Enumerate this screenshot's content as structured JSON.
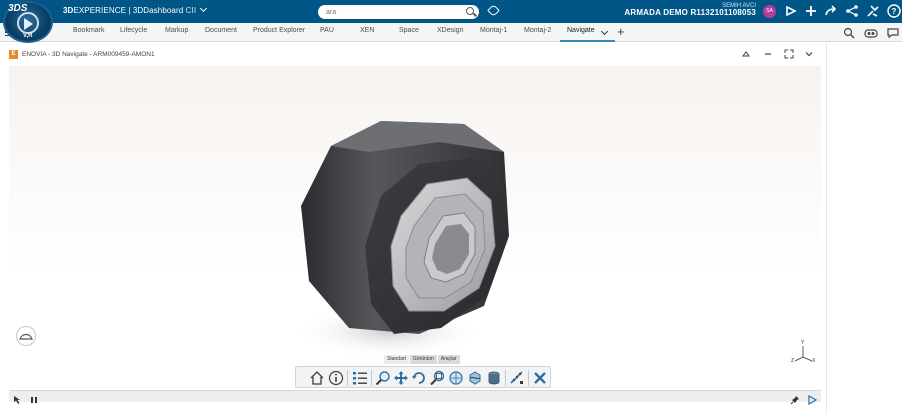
{
  "topbar": {
    "logo": "3DS",
    "compass_text": "V,R",
    "brand_prefix": "3D",
    "brand_main": "EXPERIENCE | 3DDashboard",
    "brand_suffix": "CII",
    "search_placeholder": "ara",
    "user_name": "SEMIH AVCI",
    "user_company": "ARMADA DEMO R1132101108053",
    "avatar_initials": "SA",
    "icons": [
      "tag-icon",
      "compose-icon",
      "add-icon",
      "share-icon",
      "network-icon",
      "tools-icon",
      "help-icon"
    ]
  },
  "tabs": [
    {
      "label": "Bookmark"
    },
    {
      "label": "Lifecycle"
    },
    {
      "label": "Markup"
    },
    {
      "label": "Document"
    },
    {
      "label": "Product Explorer"
    },
    {
      "label": "PAU"
    },
    {
      "label": "XEN"
    },
    {
      "label": "Space"
    },
    {
      "label": "XDesign"
    },
    {
      "label": "Montaj-1"
    },
    {
      "label": "Montaj-2"
    },
    {
      "label": "Navigate"
    }
  ],
  "active_tab": "Navigate",
  "widget": {
    "icon_letter": "E",
    "title": "ENOVIA - 3D Navigate - ARM009459-AMON1"
  },
  "viewer": {
    "toolbar_tabs": [
      "Standart",
      "Görünüm",
      "Araçlar"
    ],
    "tools": [
      "home-icon",
      "info-icon",
      "list-icon",
      "zoom-icon",
      "pan-icon",
      "rotate-icon",
      "zoom-area-icon",
      "fit-all-icon",
      "section-icon",
      "cylinder-icon",
      "measure-icon",
      "close-icon"
    ],
    "axis_labels": {
      "y": "Y",
      "z": "Z",
      "x": "X"
    }
  },
  "colors": {
    "topbar": "#005686",
    "accent": "#3a8ab8",
    "avatar": "#b33c9c"
  }
}
